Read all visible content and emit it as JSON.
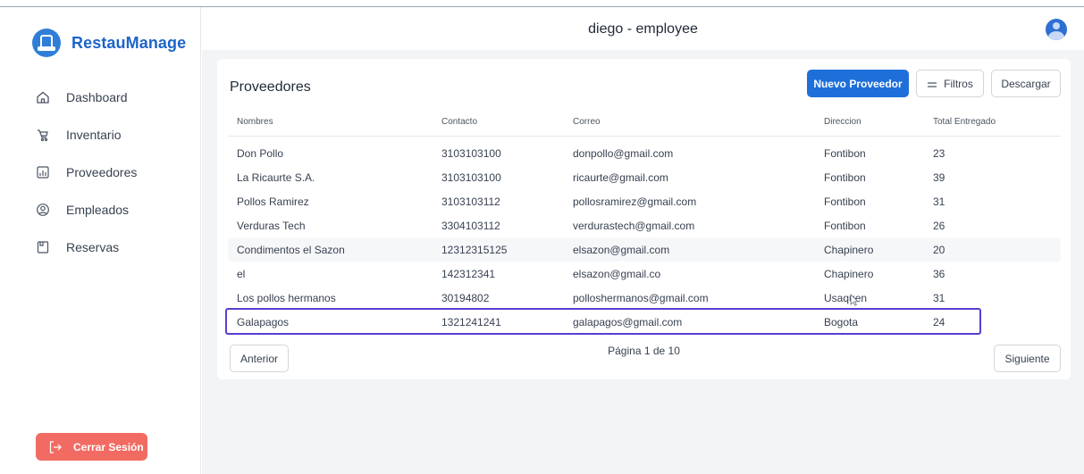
{
  "brand": {
    "name": "RestauManage"
  },
  "sidebar": {
    "items": [
      {
        "label": "Dashboard",
        "icon": "home-icon"
      },
      {
        "label": "Inventario",
        "icon": "cart-icon"
      },
      {
        "label": "Proveedores",
        "icon": "bar-chart-icon"
      },
      {
        "label": "Empleados",
        "icon": "user-circle-icon"
      },
      {
        "label": "Reservas",
        "icon": "document-icon"
      }
    ],
    "logout_label": "Cerrar Sesión"
  },
  "header": {
    "title": "diego - employee"
  },
  "main": {
    "title": "Proveedores",
    "buttons": {
      "new": "Nuevo Proveedor",
      "filters": "Filtros",
      "download": "Descargar"
    },
    "table": {
      "columns": [
        "Nombres",
        "Contacto",
        "Correo",
        "Direccion",
        "Total Entregado"
      ],
      "rows": [
        [
          "Don Pollo",
          "3103103100",
          "donpollo@gmail.com",
          "Fontibon",
          "23"
        ],
        [
          "La Ricaurte S.A.",
          "3103103100",
          "ricaurte@gmail.com",
          "Fontibon",
          "39"
        ],
        [
          "Pollos Ramirez",
          "3103103112",
          "pollosramirez@gmail.com",
          "Fontibon",
          "31"
        ],
        [
          "Verduras Tech",
          "3304103112",
          "verdurastech@gmail.com",
          "Fontibon",
          "26"
        ],
        [
          "Condimentos el Sazon",
          "12312315125",
          "elsazon@gmail.com",
          "Chapinero",
          "20"
        ],
        [
          "el",
          "142312341",
          "elsazon@gmail.co",
          "Chapinero",
          "36"
        ],
        [
          "Los pollos hermanos",
          "30194802",
          "polloshermanos@gmail.com",
          "Usaquen",
          "31"
        ],
        [
          "Galapagos",
          "1321241241",
          "galapagos@gmail.com",
          "Bogota",
          "24"
        ]
      ]
    },
    "pagination": {
      "prev": "Anterior",
      "label": "Página 1 de 10",
      "next": "Siguiente"
    }
  },
  "colors": {
    "accent": "#1e6fd9",
    "logout": "#f26b63",
    "selection": "#5b3ed0"
  }
}
